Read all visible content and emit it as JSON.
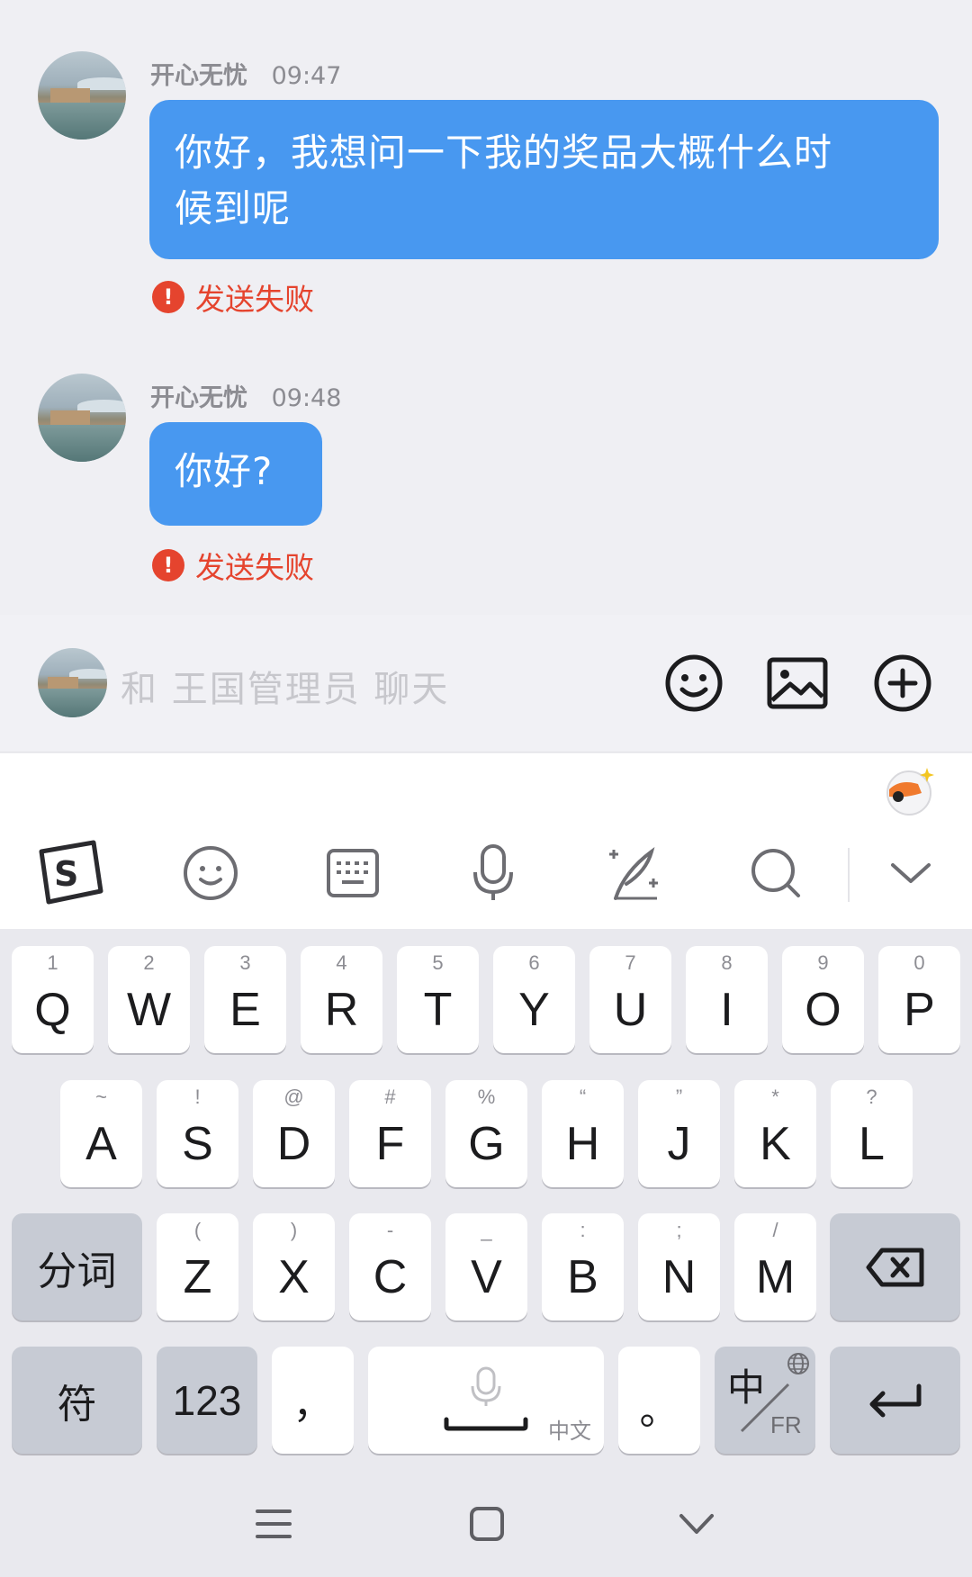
{
  "messages": [
    {
      "name": "开心无忧",
      "time": "09:47",
      "text_line1": "你好，我想问一下我的奖品大概什么时",
      "text_line2": "候到呢",
      "status": "发送失败"
    },
    {
      "name": "开心无忧",
      "time": "09:48",
      "text": "你好?",
      "status": "发送失败"
    }
  ],
  "input": {
    "placeholder": "和 王国管理员 聊天",
    "buttons": [
      "emoji-icon",
      "image-icon",
      "plus-icon"
    ]
  },
  "keyboard": {
    "toolbar": [
      "sogou-logo-icon",
      "emoji-icon",
      "keyboard-icon",
      "microphone-icon",
      "handwriting-icon",
      "search-icon",
      "chevron-down-icon"
    ],
    "row1": [
      {
        "k": "Q",
        "h": "1"
      },
      {
        "k": "W",
        "h": "2"
      },
      {
        "k": "E",
        "h": "3"
      },
      {
        "k": "R",
        "h": "4"
      },
      {
        "k": "T",
        "h": "5"
      },
      {
        "k": "Y",
        "h": "6"
      },
      {
        "k": "U",
        "h": "7"
      },
      {
        "k": "I",
        "h": "8"
      },
      {
        "k": "O",
        "h": "9"
      },
      {
        "k": "P",
        "h": "0"
      }
    ],
    "row2": [
      {
        "k": "A",
        "h": "~"
      },
      {
        "k": "S",
        "h": "!"
      },
      {
        "k": "D",
        "h": "@"
      },
      {
        "k": "F",
        "h": "#"
      },
      {
        "k": "G",
        "h": "%"
      },
      {
        "k": "H",
        "h": "“"
      },
      {
        "k": "J",
        "h": "”"
      },
      {
        "k": "K",
        "h": "*"
      },
      {
        "k": "L",
        "h": "?"
      }
    ],
    "row3": [
      {
        "k": "Z",
        "h": "("
      },
      {
        "k": "X",
        "h": ")"
      },
      {
        "k": "C",
        "h": "-"
      },
      {
        "k": "V",
        "h": "_"
      },
      {
        "k": "B",
        "h": ":"
      },
      {
        "k": "N",
        "h": ";"
      },
      {
        "k": "M",
        "h": "/"
      }
    ],
    "segment_label": "分词",
    "symbol_label": "符",
    "number_label": "123",
    "comma_label": "，",
    "space_label": "中文",
    "period_label": "。",
    "lang_switch_top": "中",
    "lang_switch_bottom": "FR"
  },
  "navbar": [
    "menu-icon",
    "home-icon",
    "back-chevron-icon"
  ]
}
